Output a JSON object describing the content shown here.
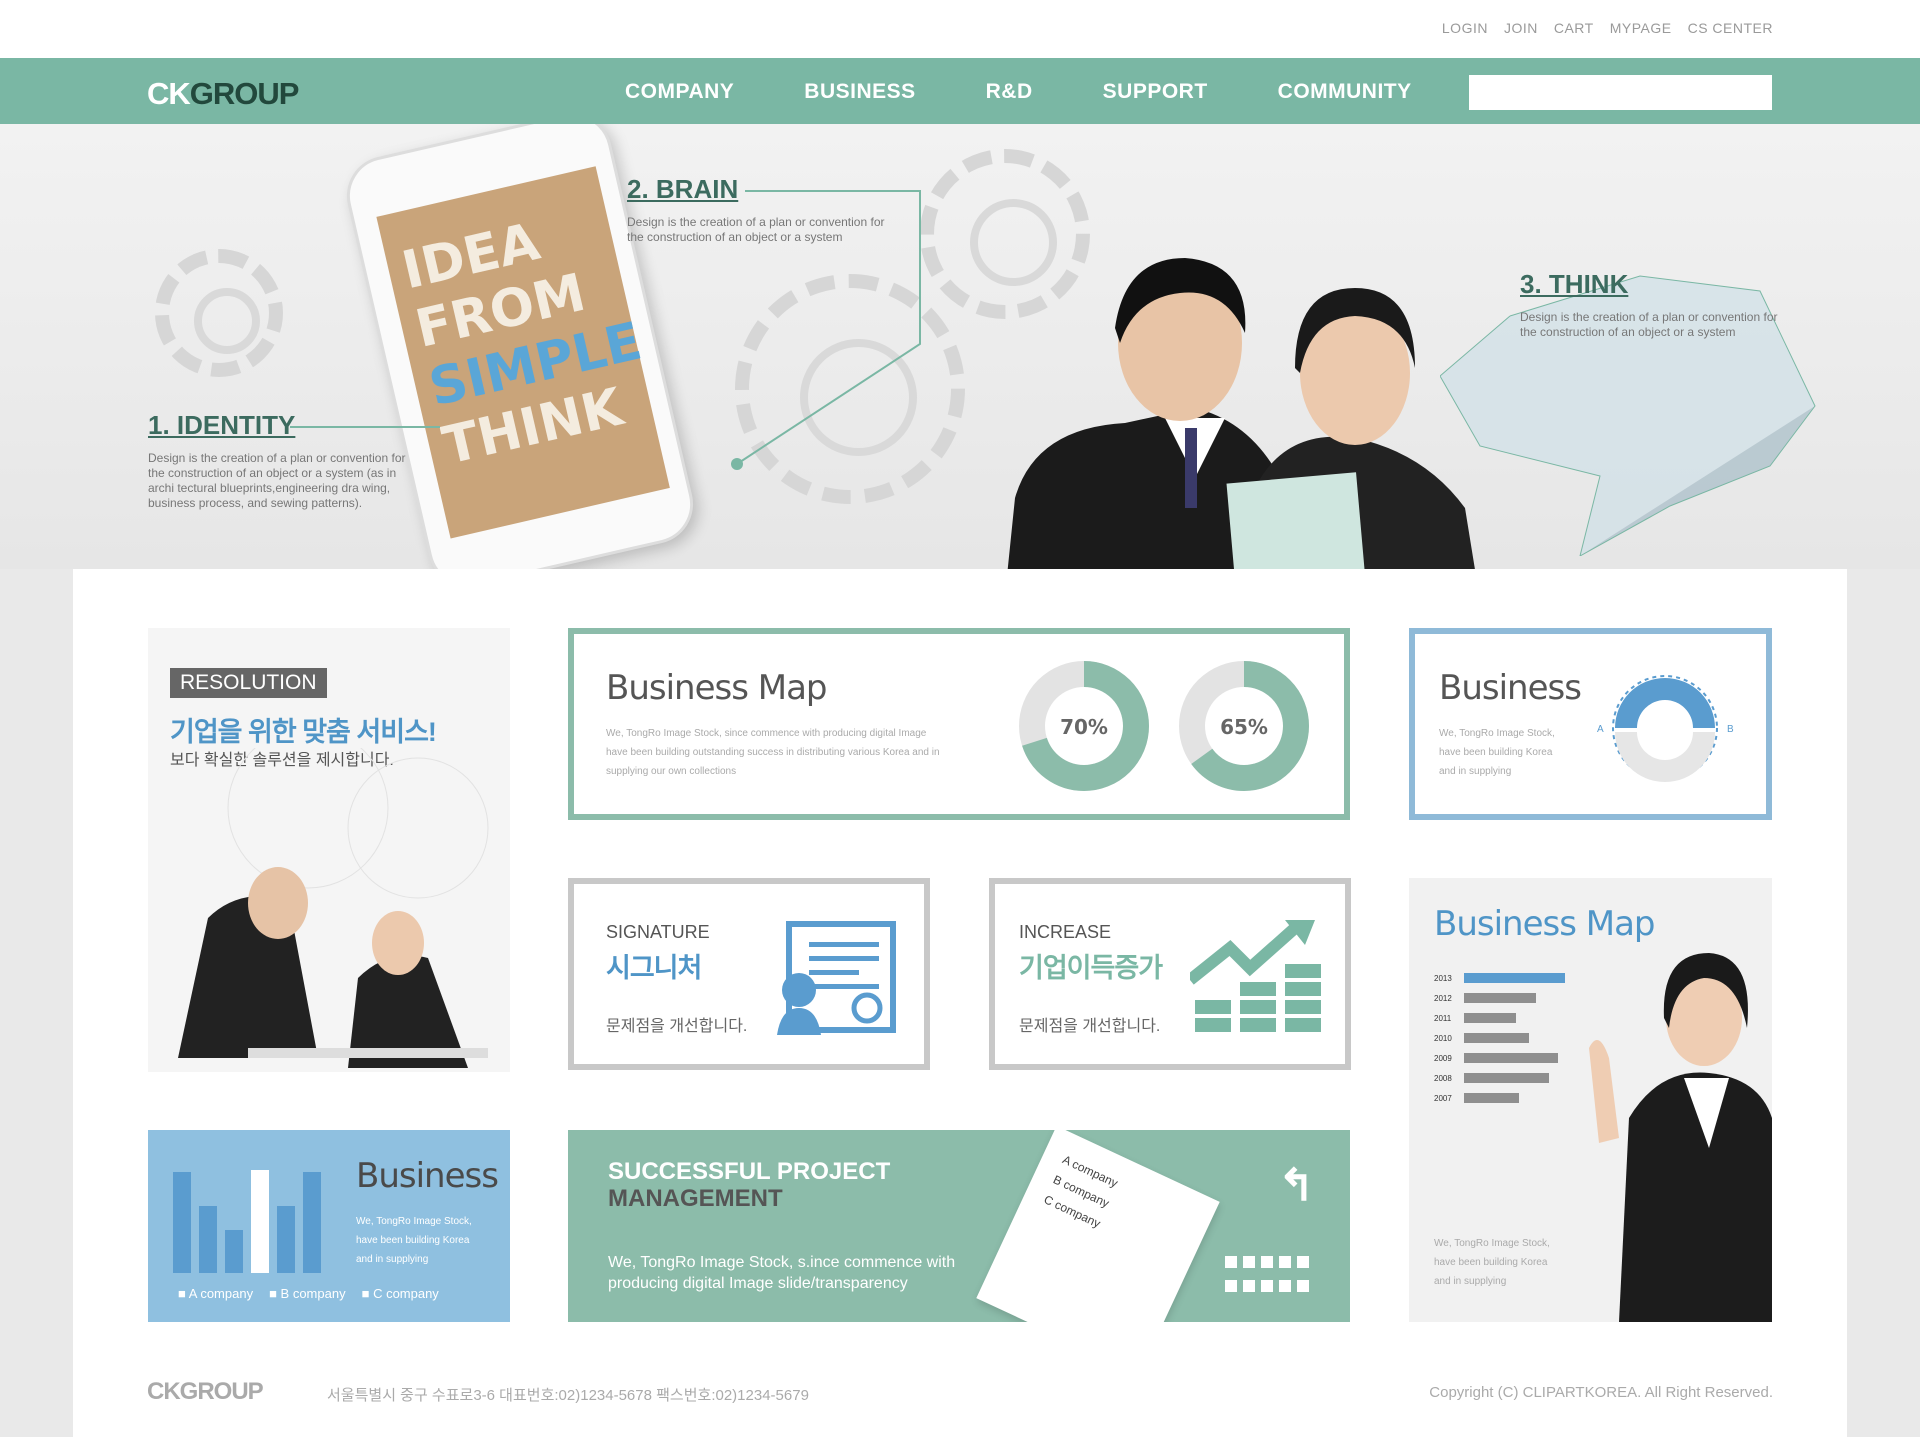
{
  "util_nav": [
    "LOGIN",
    "JOIN",
    "CART",
    "MYPAGE",
    "CS CENTER"
  ],
  "brand": {
    "ck": "CK",
    "group": "GROUP"
  },
  "menu": [
    "COMPANY",
    "BUSINESS",
    "R&D",
    "SUPPORT",
    "COMMUNITY"
  ],
  "search": {
    "placeholder": ""
  },
  "hero": {
    "phone_lines": [
      "IDEA",
      "FROM",
      "SIMPLE",
      "THINK"
    ],
    "identity": {
      "title": "1. IDENTITY",
      "text": "Design is the creation of a plan or convention for the construction of an object or a system (as in archi tectural blueprints,engineering dra wing, business process, and sewing patterns)."
    },
    "brain": {
      "title": "2. BRAIN",
      "text": "Design is the creation of a plan or convention for the construction of an object or a system"
    },
    "think": {
      "title": "3. THINK",
      "text": "Design is the creation of a plan or convention for the construction of an object or a system"
    }
  },
  "resolution": {
    "tag": "RESOLUTION",
    "headline": "기업을 위한 맞춤 서비스!",
    "sub": "보다 확실한 솔루션을 제시합니다."
  },
  "bizmap": {
    "title": "Business Map",
    "text": "We, TongRo Image Stock, since commence with producing digital Image have been building outstanding success in distributing various Korea and in supplying our own collections",
    "donut1": "70%",
    "donut2": "65%",
    "donut1_value": 70,
    "donut2_value": 65
  },
  "business_card": {
    "title": "Business",
    "text": "We, TongRo Image Stock, have been building Korea and in supplying",
    "a": "A",
    "b": "B"
  },
  "signature": {
    "en": "SIGNATURE",
    "ko": "시그니처",
    "desc": "문제점을 개선합니다."
  },
  "increase": {
    "en": "INCREASE",
    "ko": "기업이득증가",
    "desc": "문제점을 개선합니다."
  },
  "bizmap2": {
    "title": "Business Map",
    "years": [
      "2013",
      "2012",
      "2011",
      "2010",
      "2009",
      "2008",
      "2007"
    ],
    "values": [
      78,
      55,
      40,
      50,
      72,
      65,
      42
    ],
    "text": "We, TongRo Image Stock, have been building Korea and in supplying"
  },
  "bars_card": {
    "title": "Business",
    "text": "We, TongRo Image Stock, have been building Korea and in supplying",
    "legend": [
      "A company",
      "B company",
      "C company"
    ],
    "bars": [
      90,
      60,
      38,
      92,
      60,
      90
    ]
  },
  "project": {
    "title1": "SUCCESSFUL PROJECT",
    "title2": "MANAGEMENT",
    "text": "We, TongRo Image Stock, s.ince commence with producing digital Image slide/transparency",
    "companies": [
      "A company",
      "B company",
      "C company"
    ]
  },
  "footer": {
    "logo": "CKGROUP",
    "address": "서울특별시 중구 수표로3-6  대표번호:02)1234-5678  팩스번호:02)1234-5679",
    "copyright": "Copyright (C) CLIPARTKOREA. All Right Reserved."
  },
  "colors": {
    "accent": "#7ab7a4",
    "blue": "#5a9ccf",
    "dark": "#22483c"
  }
}
